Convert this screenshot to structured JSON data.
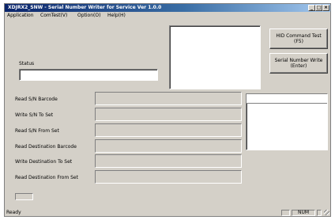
{
  "window": {
    "title": "XDJRX2_SNW - Serial Number Writer for Service  Ver 1.0.0"
  },
  "window_controls": {
    "minimize": "_",
    "maximize": "□",
    "close": "×"
  },
  "menu": [
    "Application",
    "ComTest(V)",
    "Option(O)",
    "Help(H)"
  ],
  "status": {
    "label": "Status",
    "value": ""
  },
  "buttons": {
    "hid_line1": "HID Command Test",
    "hid_line2": "(F5)",
    "write_line1": "Serial Number Write",
    "write_line2": "(Enter)"
  },
  "fields": [
    {
      "label": "Read S/N Barcode",
      "value": ""
    },
    {
      "label": "Write S/N To Set",
      "value": ""
    },
    {
      "label": "Read S/N From Set",
      "value": ""
    },
    {
      "label": "Read Destination Barcode",
      "value": ""
    },
    {
      "label": "Write Destination To Set",
      "value": ""
    },
    {
      "label": "Read Destination From Set",
      "value": ""
    }
  ],
  "statusbar": {
    "text": "Ready",
    "indicator": "NUM"
  }
}
